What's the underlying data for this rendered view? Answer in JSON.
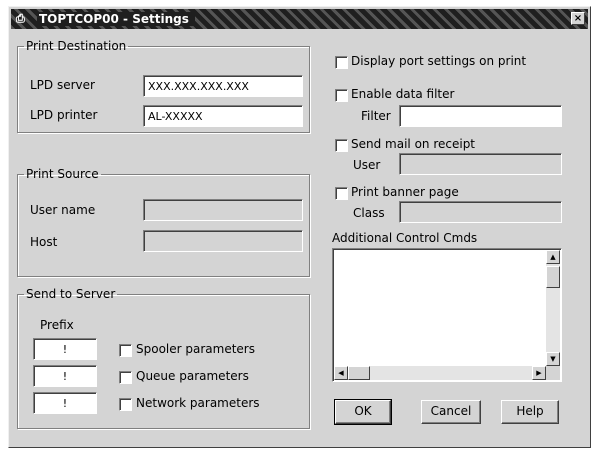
{
  "window": {
    "title": "TOPTCOP00 - Settings",
    "sys_icon": "printer-icon",
    "close_glyph": "×"
  },
  "print_destination": {
    "legend": "Print Destination",
    "lpd_server_label": "LPD server",
    "lpd_server_value": "XXX.XXX.XXX.XXX",
    "lpd_printer_label": "LPD printer",
    "lpd_printer_value": "AL-XXXXX"
  },
  "print_source": {
    "legend": "Print Source",
    "user_name_label": "User name",
    "user_name_value": "",
    "host_label": "Host",
    "host_value": ""
  },
  "send_to_server": {
    "legend": "Send to Server",
    "prefix_header": "Prefix",
    "rows": [
      {
        "prefix": "!",
        "label": "Spooler parameters"
      },
      {
        "prefix": "!",
        "label": "Queue parameters"
      },
      {
        "prefix": "!",
        "label": "Network parameters"
      }
    ]
  },
  "options": {
    "display_port_label": "Display port settings on print",
    "enable_data_filter_label": "Enable data filter",
    "filter_field_label": "Filter",
    "send_mail_label": "Send mail on receipt",
    "mail_field_label": "User",
    "print_banner_label": "Print banner page",
    "banner_field_label": "Class"
  },
  "additional_control": {
    "label": "Additional Control Cmds",
    "value": ""
  },
  "buttons": {
    "ok": "OK",
    "cancel": "Cancel",
    "help": "Help"
  }
}
